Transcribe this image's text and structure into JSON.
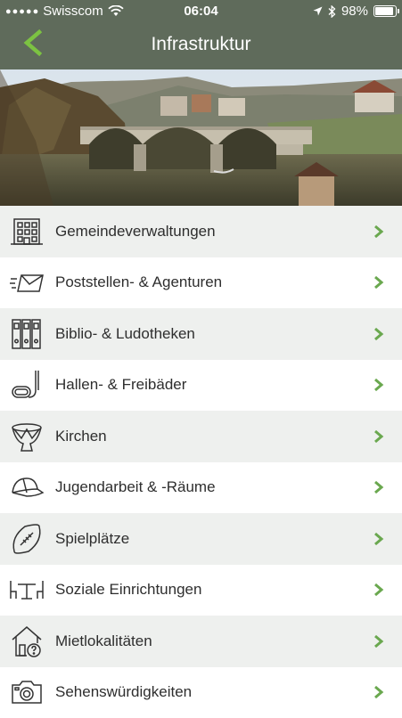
{
  "status_bar": {
    "carrier": "Swisscom",
    "time": "06:04",
    "battery": "98%"
  },
  "nav": {
    "title": "Infrastruktur",
    "back_icon": "back-chevron-icon"
  },
  "hero": {
    "image": "river-bridge-photo"
  },
  "colors": {
    "header": "#5f6b5b",
    "accent": "#6aa84f",
    "row_alt": "#eef0ee"
  },
  "menu": [
    {
      "label": "Gemeindeverwaltungen",
      "icon": "building-icon"
    },
    {
      "label": "Poststellen- & Agenturen",
      "icon": "envelope-icon"
    },
    {
      "label": "Biblio- & Ludotheken",
      "icon": "binders-icon"
    },
    {
      "label": "Hallen- & Freibäder",
      "icon": "snorkel-icon"
    },
    {
      "label": "Kirchen",
      "icon": "drum-icon"
    },
    {
      "label": "Jugendarbeit & -Räume",
      "icon": "cap-icon"
    },
    {
      "label": "Spielplätze",
      "icon": "football-icon"
    },
    {
      "label": "Soziale Einrichtungen",
      "icon": "table-chairs-icon"
    },
    {
      "label": "Mietlokalitäten",
      "icon": "house-question-icon"
    },
    {
      "label": "Sehenswürdigkeiten",
      "icon": "camera-icon"
    }
  ]
}
